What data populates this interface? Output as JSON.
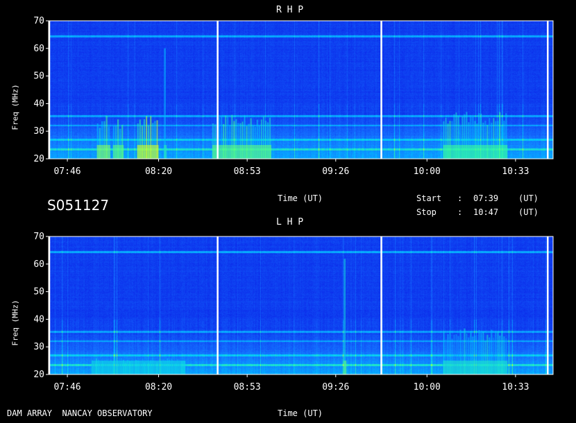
{
  "chart_data": [
    {
      "type": "heatmap",
      "title": "R H P",
      "ylabel": "Freq (MHz)",
      "xlabel": "Time (UT)",
      "ylim": [
        20,
        70
      ],
      "yticks": [
        20,
        30,
        40,
        50,
        60,
        70
      ],
      "xticks": [
        "07:46",
        "08:20",
        "08:53",
        "09:26",
        "10:00",
        "10:33"
      ],
      "time_range": [
        "07:39",
        "10:47"
      ],
      "colormap": [
        "#0a1ee6",
        "#00b4ff",
        "#32ff9a",
        "#ffff00"
      ],
      "vertical_markers": [
        "07:39",
        "08:42",
        "09:43",
        "10:45"
      ],
      "burst_clusters": [
        {
          "start": "07:57",
          "end": "08:02",
          "fmin": 20,
          "fmax": 36,
          "level": 0.85
        },
        {
          "start": "08:03",
          "end": "08:07",
          "fmin": 20,
          "fmax": 35,
          "level": 0.8
        },
        {
          "start": "08:12",
          "end": "08:20",
          "fmin": 20,
          "fmax": 36,
          "level": 0.95
        },
        {
          "start": "08:22",
          "end": "08:23",
          "fmin": 20,
          "fmax": 70,
          "level": 0.7
        },
        {
          "start": "08:40",
          "end": "09:02",
          "fmin": 20,
          "fmax": 36,
          "level": 0.8
        },
        {
          "start": "10:06",
          "end": "10:30",
          "fmin": 20,
          "fmax": 37,
          "level": 0.75
        }
      ]
    },
    {
      "type": "heatmap",
      "title": "L H P",
      "ylabel": "Freq (MHz)",
      "xlabel": "Time (UT)",
      "ylim": [
        20,
        70
      ],
      "yticks": [
        20,
        30,
        40,
        50,
        60,
        70
      ],
      "xticks": [
        "07:46",
        "08:20",
        "08:53",
        "09:26",
        "10:00",
        "10:33"
      ],
      "time_range": [
        "07:39",
        "10:47"
      ],
      "colormap": [
        "#0a1ee6",
        "#00b4ff",
        "#32ff9a",
        "#ffff00"
      ],
      "vertical_markers": [
        "07:39",
        "08:42",
        "09:43",
        "10:45"
      ],
      "burst_clusters": [
        {
          "start": "07:55",
          "end": "08:30",
          "fmin": 20,
          "fmax": 26,
          "level": 0.6
        },
        {
          "start": "09:29",
          "end": "09:30",
          "fmin": 20,
          "fmax": 67,
          "level": 0.8
        },
        {
          "start": "10:06",
          "end": "10:30",
          "fmin": 20,
          "fmax": 37,
          "level": 0.65
        }
      ]
    }
  ],
  "header": {
    "session_id": "S051127",
    "time_label": "Time (UT)",
    "start_label": "Start",
    "stop_label": "Stop",
    "colon": ":",
    "start_time": "07:39",
    "stop_time": "10:47",
    "unit": "(UT)"
  },
  "footer": {
    "observatory": "DAM ARRAY  NANCAY OBSERVATORY",
    "time_label": "Time (UT)"
  }
}
